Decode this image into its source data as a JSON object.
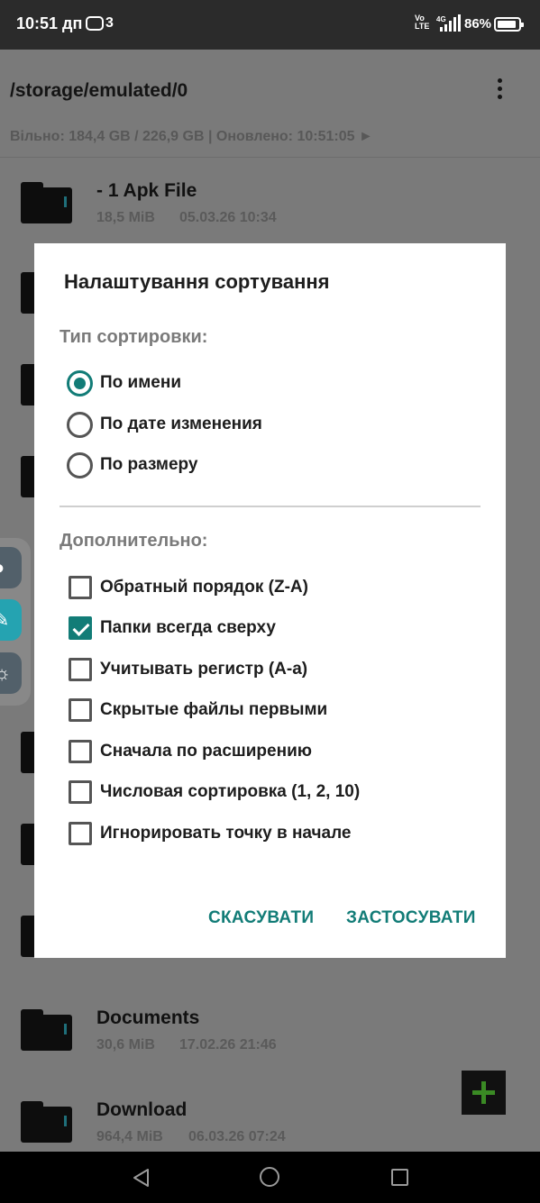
{
  "status_bar": {
    "time": "10:51 дп",
    "notification_count": "3",
    "network": "Vo LTE 4G",
    "battery": "86%"
  },
  "header": {
    "path": "/storage/emulated/0",
    "storage_info": "Вільно: 184,4 GB / 226,9 GB | Оновлено: 10:51:05 ►",
    "menu_icon": "more-vert-icon"
  },
  "files": [
    {
      "name": "- 1 Apk File",
      "size": "18,5 MiB",
      "date": "05.03.26 10:34"
    },
    {
      "name": "Documents",
      "size": "30,6 MiB",
      "date": "17.02.26 21:46"
    },
    {
      "name": "Download",
      "size": "964,4 MiB",
      "date": "06.03.26 07:24"
    }
  ],
  "dialog": {
    "title": "Налаштування сортування",
    "sort_type_label": "Тип сортировки:",
    "sort_options": [
      {
        "label": "По имени",
        "selected": true
      },
      {
        "label": "По дате изменения",
        "selected": false
      },
      {
        "label": "По размеру",
        "selected": false
      }
    ],
    "extra_label": "Дополнительно:",
    "extra_options": [
      {
        "label": "Обратный порядок (Z-A)",
        "checked": false
      },
      {
        "label": "Папки всегда сверху",
        "checked": true
      },
      {
        "label": "Учитывать регистр (А-а)",
        "checked": false
      },
      {
        "label": "Скрытые файлы первыми",
        "checked": false
      },
      {
        "label": "Сначала по расширению",
        "checked": false
      },
      {
        "label": "Числовая сортировка (1, 2, 10)",
        "checked": false
      },
      {
        "label": "Игнорировать точку в начале",
        "checked": false
      }
    ],
    "cancel_label": "СКАСУВАТИ",
    "apply_label": "ЗАСТОСУВАТИ"
  },
  "colors": {
    "accent": "#127c77",
    "scrim": "#7a7a7a",
    "fab_plus": "#3a8a24"
  },
  "icons": {
    "fab": "plus-icon",
    "side_panel": [
      "record-icon",
      "pin-icon",
      "brightness-icon"
    ],
    "nav": [
      "back-icon",
      "home-icon",
      "recents-icon"
    ]
  }
}
